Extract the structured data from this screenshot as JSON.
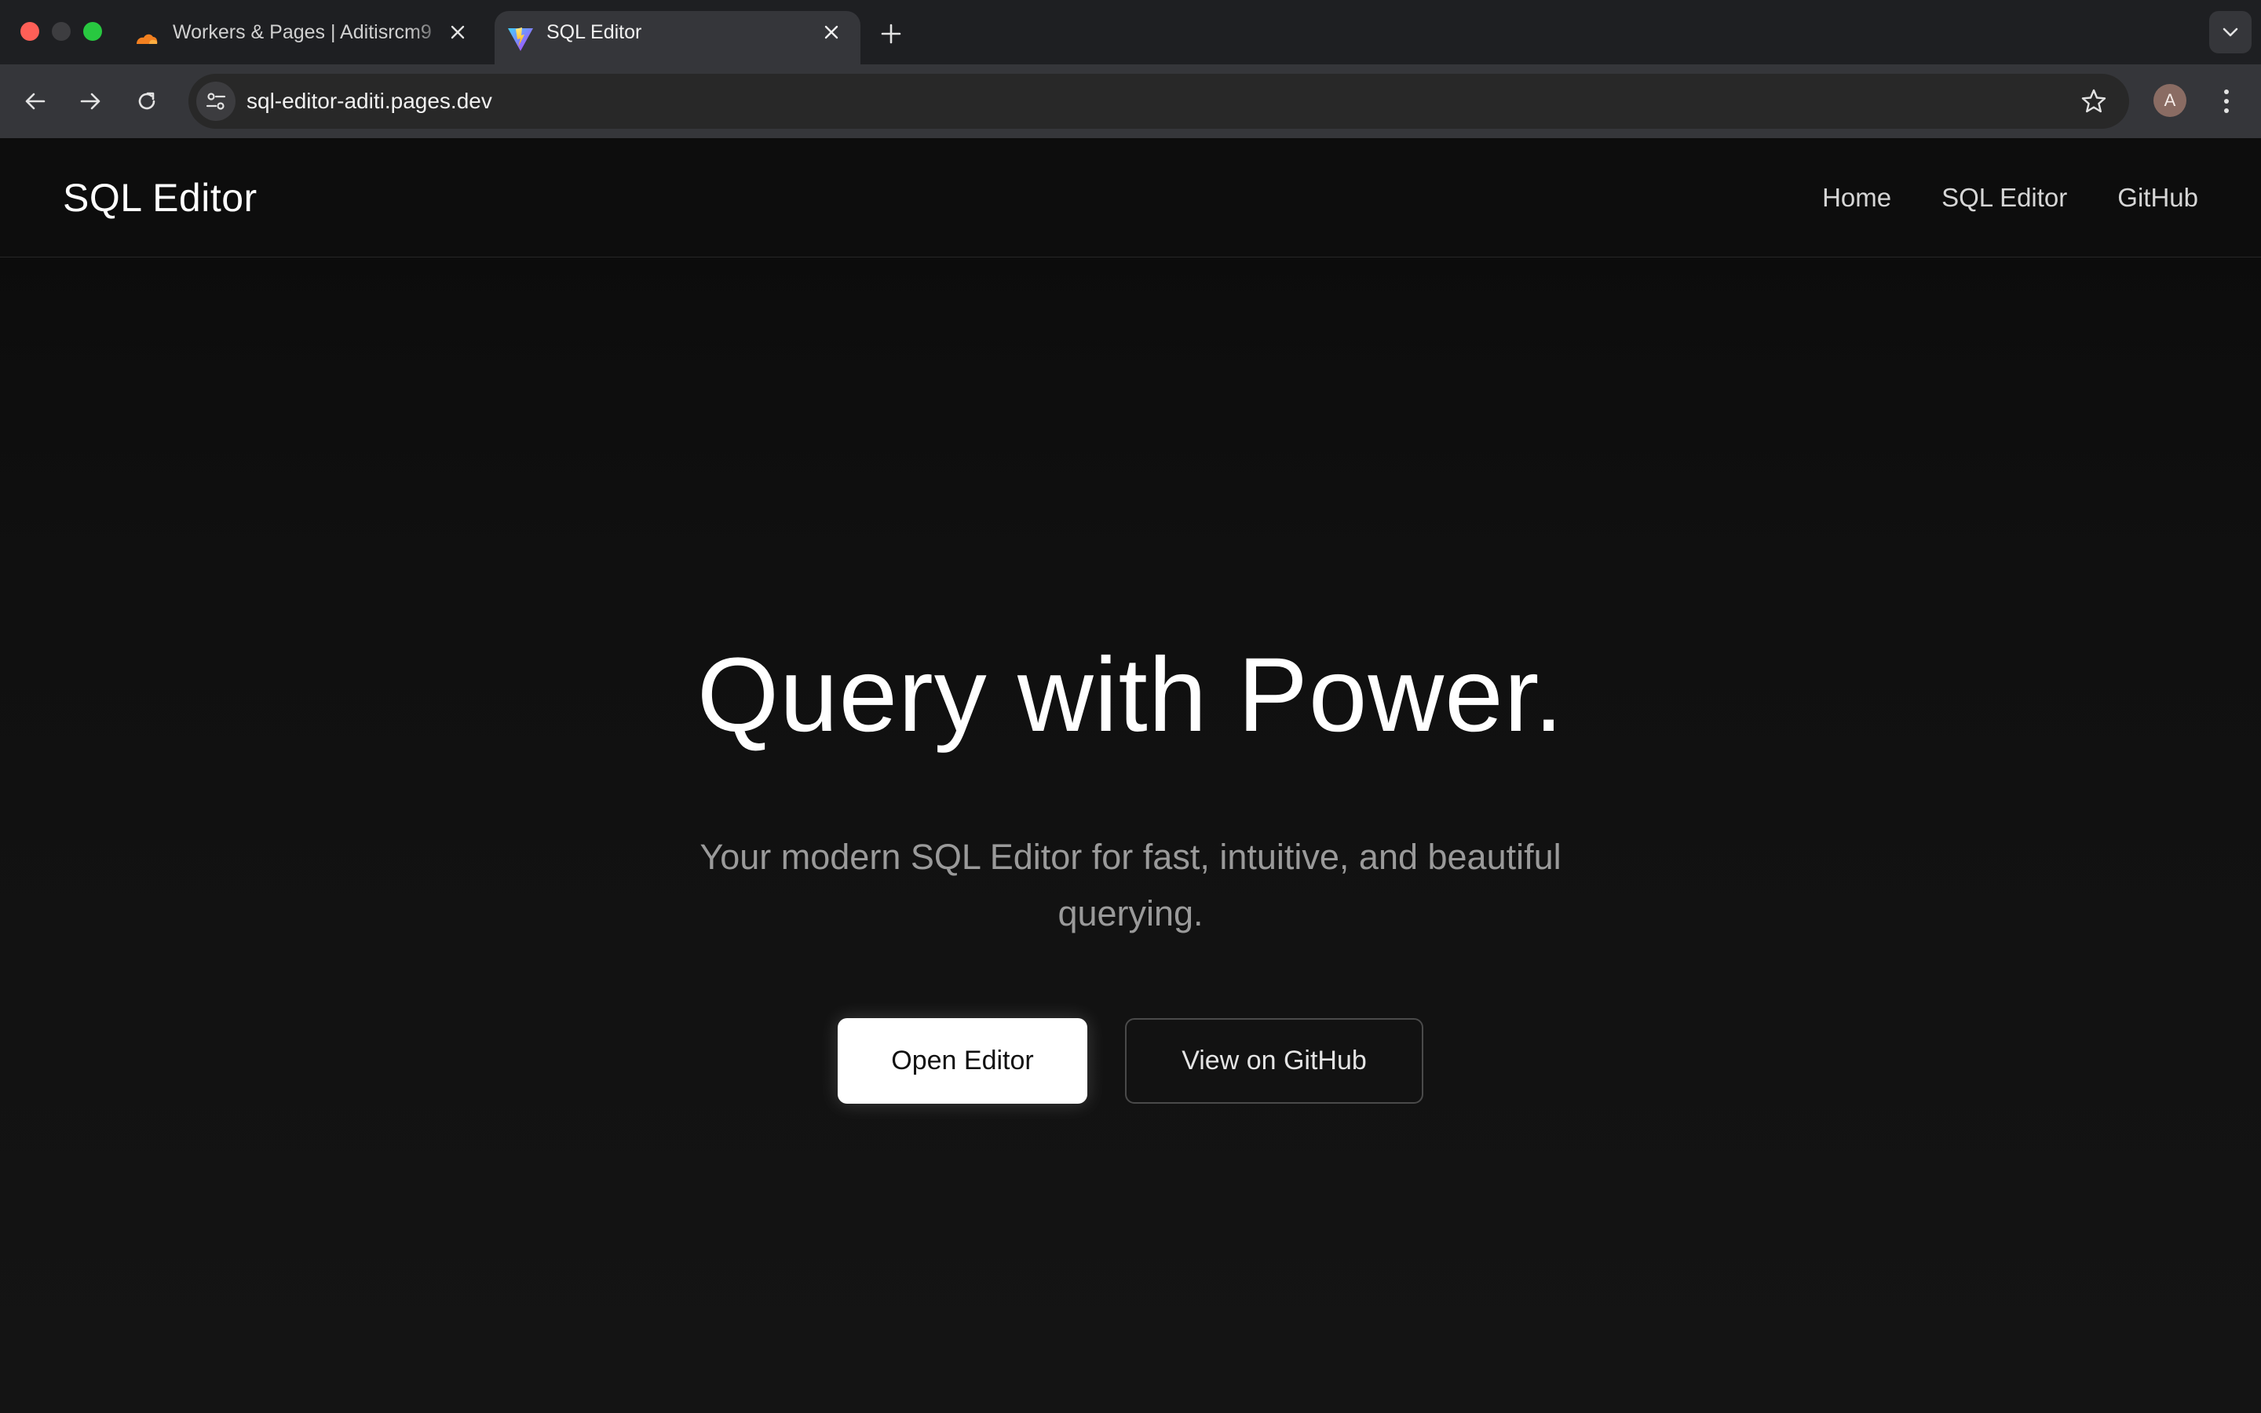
{
  "browser": {
    "tabs": [
      {
        "title": "Workers & Pages | Aditisrcm9",
        "active": false,
        "icon": "cloudflare-icon"
      },
      {
        "title": "SQL Editor",
        "active": true,
        "icon": "vite-icon"
      }
    ],
    "url": "sql-editor-aditi.pages.dev",
    "profile_initial": "A"
  },
  "site": {
    "brand": "SQL Editor",
    "nav": [
      {
        "label": "Home"
      },
      {
        "label": "SQL Editor"
      },
      {
        "label": "GitHub"
      }
    ]
  },
  "hero": {
    "title": "Query with Power.",
    "subtitle": "Your modern SQL Editor for fast, intuitive, and beautiful querying.",
    "primary_button": "Open Editor",
    "secondary_button": "View on GitHub"
  },
  "colors": {
    "background": "#121212",
    "header_background": "#0d0d0d",
    "primary_button_bg": "#ffffff",
    "subtitle_text": "#9a9a9a"
  }
}
